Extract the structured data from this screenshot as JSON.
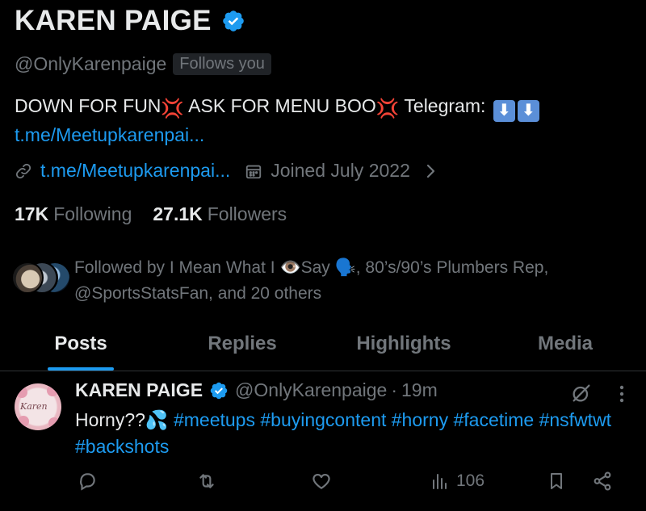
{
  "profile": {
    "display_name": "KAREN PAIGE",
    "handle": "@OnlyKarenpaige",
    "follows_you": "Follows you",
    "bio_part1": "DOWN FOR FUN",
    "bio_part2": " ASK FOR MENU BOO",
    "bio_part3": " Telegram: ",
    "bio_link": "t.me/Meetupkarenpai...",
    "anger_emoji": "💢",
    "arrow_emoji": "⬇",
    "website": "t.me/Meetupkarenpai...",
    "joined": "Joined July 2022",
    "following_count": "17K",
    "following_label": "Following",
    "followers_count": "27.1K",
    "followers_label": "Followers",
    "followed_by": "Followed by I Mean What I 👁️Say 🗣️, 80’s/90’s Plumbers Rep, @SportsStatsFan, and 20 others",
    "verified_color": "#1d9bf0"
  },
  "tabs": [
    {
      "label": "Posts",
      "active": true
    },
    {
      "label": "Replies",
      "active": false
    },
    {
      "label": "Highlights",
      "active": false
    },
    {
      "label": "Media",
      "active": false
    }
  ],
  "post": {
    "name": "KAREN PAIGE",
    "handle": "@OnlyKarenpaige",
    "separator": "·",
    "time": "19m",
    "avatar_text": "Karen",
    "text_start": "Horny??💦 ",
    "hashtags": "#meetups #buyingcontent #horny #facetime #nsfwtwt #backshots",
    "views": "106"
  },
  "colors": {
    "accent": "#1d9bf0",
    "muted": "#71767b",
    "text": "#e7e9ea",
    "background": "#000000"
  }
}
